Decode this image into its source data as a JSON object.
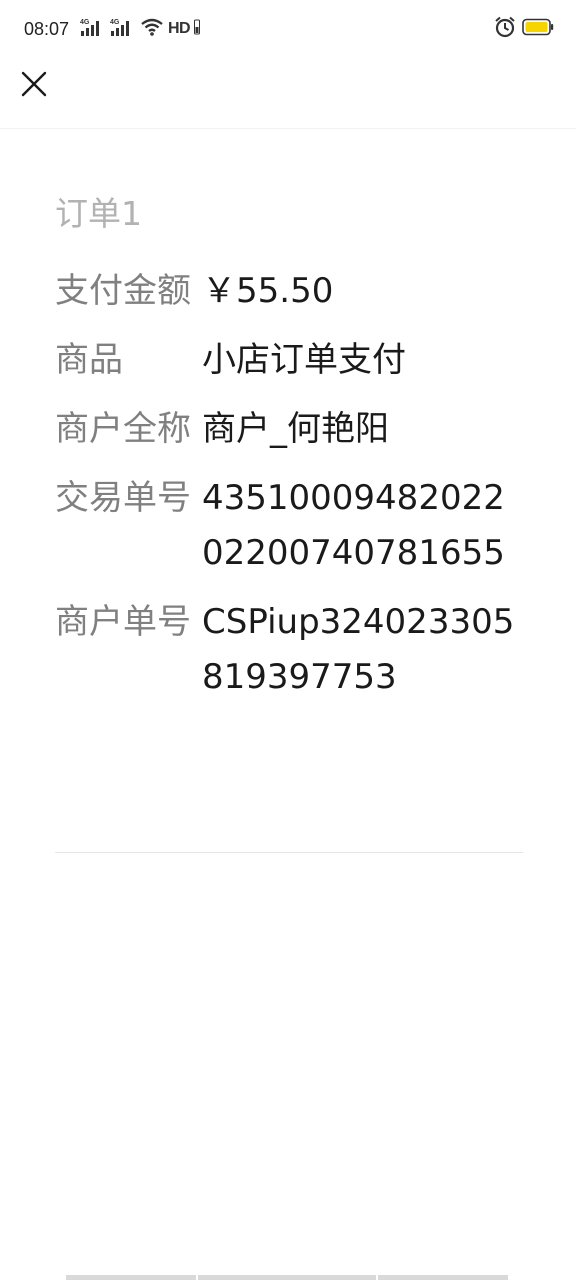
{
  "status_bar": {
    "time": "08:07",
    "network_label": "HD",
    "icons": [
      "signal-4g-icon",
      "signal-4g-icon",
      "wifi-icon",
      "alarm-icon",
      "battery-icon"
    ],
    "battery_color": "#f5d400"
  },
  "top_bar": {
    "close_icon": "close-icon"
  },
  "order": {
    "title": "订单1",
    "rows": [
      {
        "label": "支付金额",
        "value": "￥55.50"
      },
      {
        "label": "商品",
        "value": "小店订单支付"
      },
      {
        "label": "商户全称",
        "value": "商户_何艳阳"
      },
      {
        "label": "交易单号",
        "value": "4351000948202202200740781655"
      },
      {
        "label": "商户单号",
        "value": "CSPiup324023305819397753"
      }
    ]
  },
  "colors": {
    "label": "#808080",
    "title": "#b2b2b2",
    "value": "#1a1a1a",
    "divider": "#e6e6e6"
  }
}
